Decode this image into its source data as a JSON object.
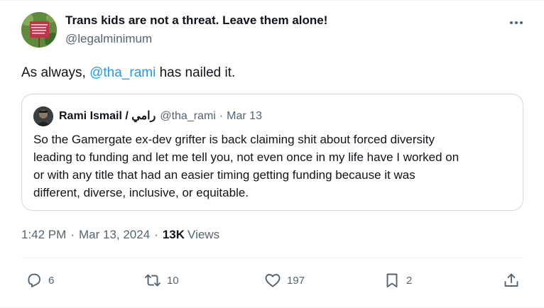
{
  "tweet": {
    "author_name": "Trans kids are not a threat. Leave them alone!",
    "author_handle": "@legalminimum",
    "text_prefix": "As always, ",
    "mention": "@tha_rami",
    "text_suffix": " has nailed it.",
    "more_label": "···"
  },
  "quote": {
    "name": "Rami Ismail / رامي",
    "handle": "@tha_rami",
    "date": "Mar 13",
    "lines": [
      "So the Gamergate ex-dev grifter is back claiming shit about forced diversity",
      "leading to funding and let me tell you, not even once in my life have I worked on",
      "or with any title that had an easier timing getting funding because it was",
      "different, diverse, inclusive, or equitable."
    ]
  },
  "meta": {
    "time": "1:42 PM",
    "date": "Mar 13, 2024",
    "views_count": "13K",
    "views_label": "Views"
  },
  "actions": {
    "replies": "6",
    "reposts": "10",
    "likes": "197",
    "bookmarks": "2"
  },
  "icons": {
    "reply": "reply-icon",
    "repost": "repost-icon",
    "like": "heart-icon",
    "bookmark": "bookmark-icon",
    "share": "share-icon",
    "more": "more-icon"
  },
  "colors": {
    "accent": "#1d9bf0",
    "text": "#0f1419",
    "muted": "#536471",
    "border": "#cfd9de"
  }
}
